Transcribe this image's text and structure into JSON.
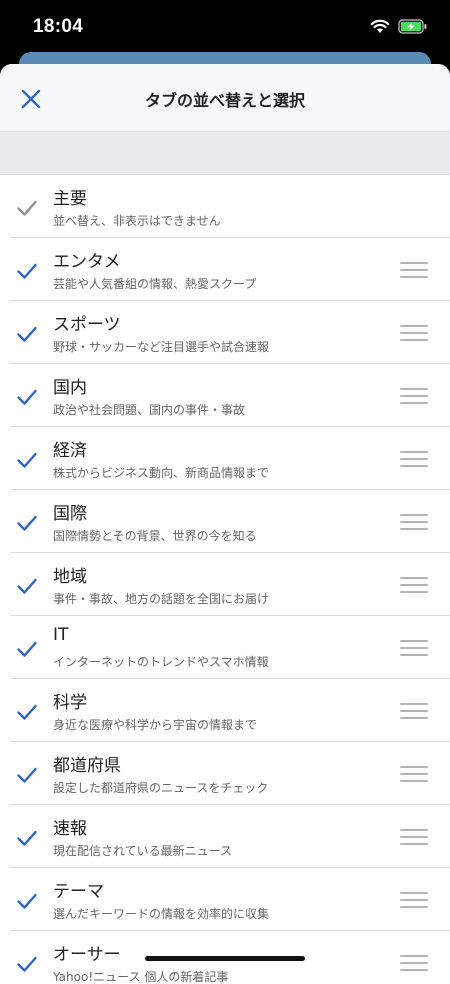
{
  "status": {
    "time": "18:04"
  },
  "header": {
    "title": "タブの並べ替えと選択",
    "close_icon": "close-icon"
  },
  "colors": {
    "accent": "#2f64c6",
    "check_disabled": "#8e8e93"
  },
  "tabs": [
    {
      "title": "主要",
      "subtitle": "並べ替え、非表示はできません",
      "checked": true,
      "locked": true
    },
    {
      "title": "エンタメ",
      "subtitle": "芸能や人気番組の情報、熱愛スクープ",
      "checked": true,
      "locked": false
    },
    {
      "title": "スポーツ",
      "subtitle": "野球・サッカーなど注目選手や試合速報",
      "checked": true,
      "locked": false
    },
    {
      "title": "国内",
      "subtitle": "政治や社会問題、国内の事件・事故",
      "checked": true,
      "locked": false
    },
    {
      "title": "経済",
      "subtitle": "株式からビジネス動向、新商品情報まで",
      "checked": true,
      "locked": false
    },
    {
      "title": "国際",
      "subtitle": "国際情勢とその背景、世界の今を知る",
      "checked": true,
      "locked": false
    },
    {
      "title": "地域",
      "subtitle": "事件・事故、地方の話題を全国にお届け",
      "checked": true,
      "locked": false
    },
    {
      "title": "IT",
      "subtitle": "インターネットのトレンドやスマホ情報",
      "checked": true,
      "locked": false
    },
    {
      "title": "科学",
      "subtitle": "身近な医療や科学から宇宙の情報まで",
      "checked": true,
      "locked": false
    },
    {
      "title": "都道府県",
      "subtitle": "設定した都道府県のニュースをチェック",
      "checked": true,
      "locked": false
    },
    {
      "title": "速報",
      "subtitle": "現在配信されている最新ニュース",
      "checked": true,
      "locked": false
    },
    {
      "title": "テーマ",
      "subtitle": "選んだキーワードの情報を効率的に収集",
      "checked": true,
      "locked": false
    },
    {
      "title": "オーサー",
      "subtitle": "Yahoo!ニュース 個人の新着記事",
      "checked": true,
      "locked": false
    }
  ]
}
